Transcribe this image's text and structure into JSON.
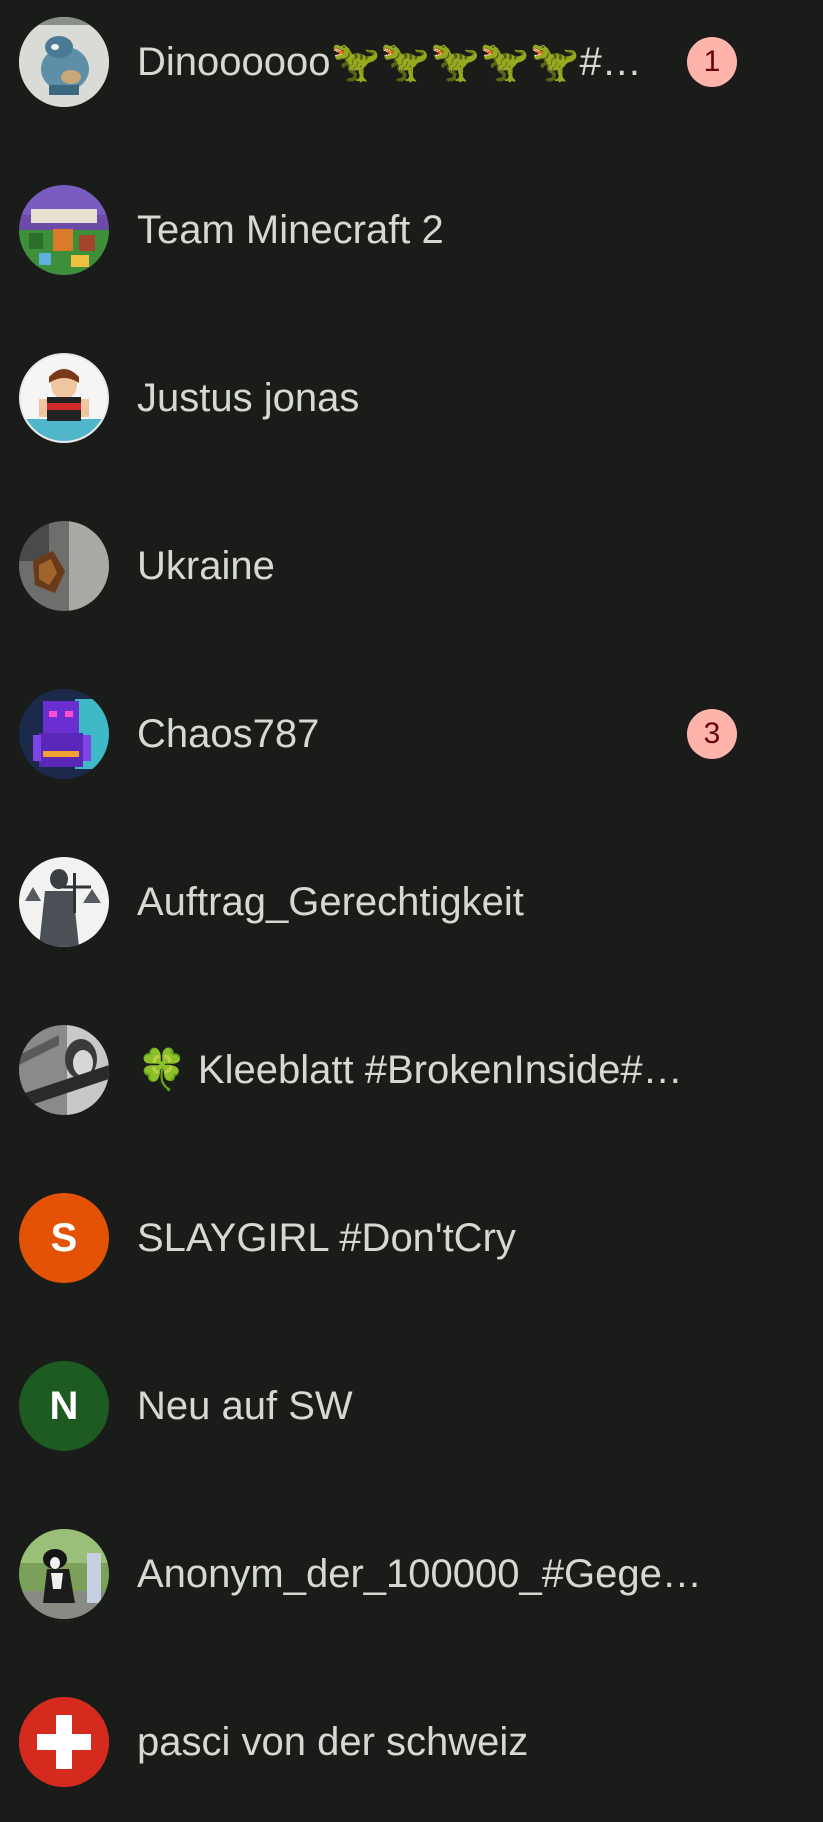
{
  "chats": [
    {
      "name": "Dinoooooo🦖🦖🦖🦖🦖#…",
      "badge": "1",
      "avatar": "dino-photo"
    },
    {
      "name": "Team Minecraft 2",
      "badge": "",
      "avatar": "minecraft-photo"
    },
    {
      "name": "Justus jonas",
      "badge": "",
      "avatar": "character-photo"
    },
    {
      "name": "Ukraine",
      "badge": "",
      "avatar": "dark-photo"
    },
    {
      "name": "Chaos787",
      "badge": "3",
      "avatar": "purple-skin-photo"
    },
    {
      "name": "Auftrag_Gerechtigkeit",
      "badge": "",
      "avatar": "justice-statue-photo"
    },
    {
      "name": "🍀 Kleeblatt #BrokenInside#…",
      "badge": "",
      "avatar": "grayscale-photo"
    },
    {
      "name": "SLAYGIRL #Don'tCry",
      "badge": "",
      "avatar": "letter",
      "initial": "S",
      "color": "#e35205"
    },
    {
      "name": "Neu auf SW",
      "badge": "",
      "avatar": "letter",
      "initial": "N",
      "color": "#1e5b22"
    },
    {
      "name": "Anonym_der_100000_#Gege…",
      "badge": "",
      "avatar": "dog-photo"
    },
    {
      "name": "pasci von der schweiz",
      "badge": "",
      "avatar": "swiss-flag"
    }
  ],
  "colors": {
    "background": "#1a1c19",
    "text": "#d6d9d2",
    "badge_bg": "#ffb4ab",
    "badge_text": "#690005"
  }
}
